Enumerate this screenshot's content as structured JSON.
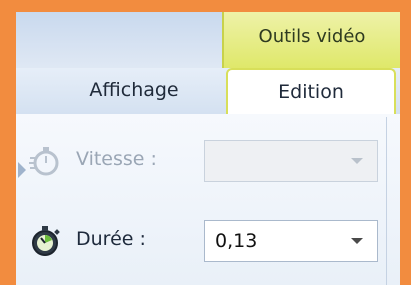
{
  "context_tab": {
    "label": "Outils vidéo"
  },
  "tabs": [
    {
      "label": "Affichage",
      "active": false
    },
    {
      "label": "Edition",
      "active": true
    }
  ],
  "speed": {
    "label": "Vitesse :",
    "value": "",
    "enabled": false,
    "icon": "speed-stopwatch-icon"
  },
  "duration": {
    "label": "Durée :",
    "value": "0,13",
    "enabled": true,
    "icon": "stopwatch-icon"
  },
  "colors": {
    "background": "#f28c3f",
    "context_tab": "#dfe86a",
    "active_tab_border": "#d8df5a"
  }
}
